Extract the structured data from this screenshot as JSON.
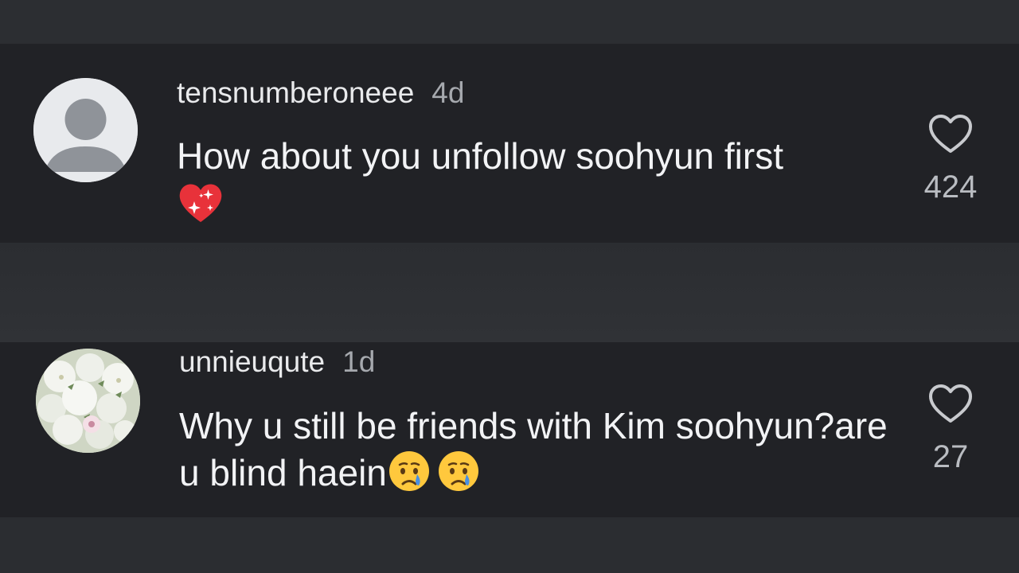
{
  "comments": [
    {
      "username": "tensnumberoneee",
      "time": "4d",
      "text": "How about you unfollow soohyun first",
      "emojis": [
        "sparkling-heart"
      ],
      "likes": "424",
      "avatar": "default-person"
    },
    {
      "username": "unnieuqute",
      "time": "1d",
      "text": "Why u still be friends with Kim soohyun?are u blind haein",
      "emojis": [
        "crying-face",
        "crying-face"
      ],
      "likes": "27",
      "avatar": "white-flowers-photo"
    }
  ],
  "colors": {
    "background": "#2a2c30",
    "comment_background": "#212226",
    "username": "#e9eaec",
    "timestamp": "#a6a9ae",
    "text": "#f2f3f5",
    "like_count": "#b9bcc1"
  }
}
